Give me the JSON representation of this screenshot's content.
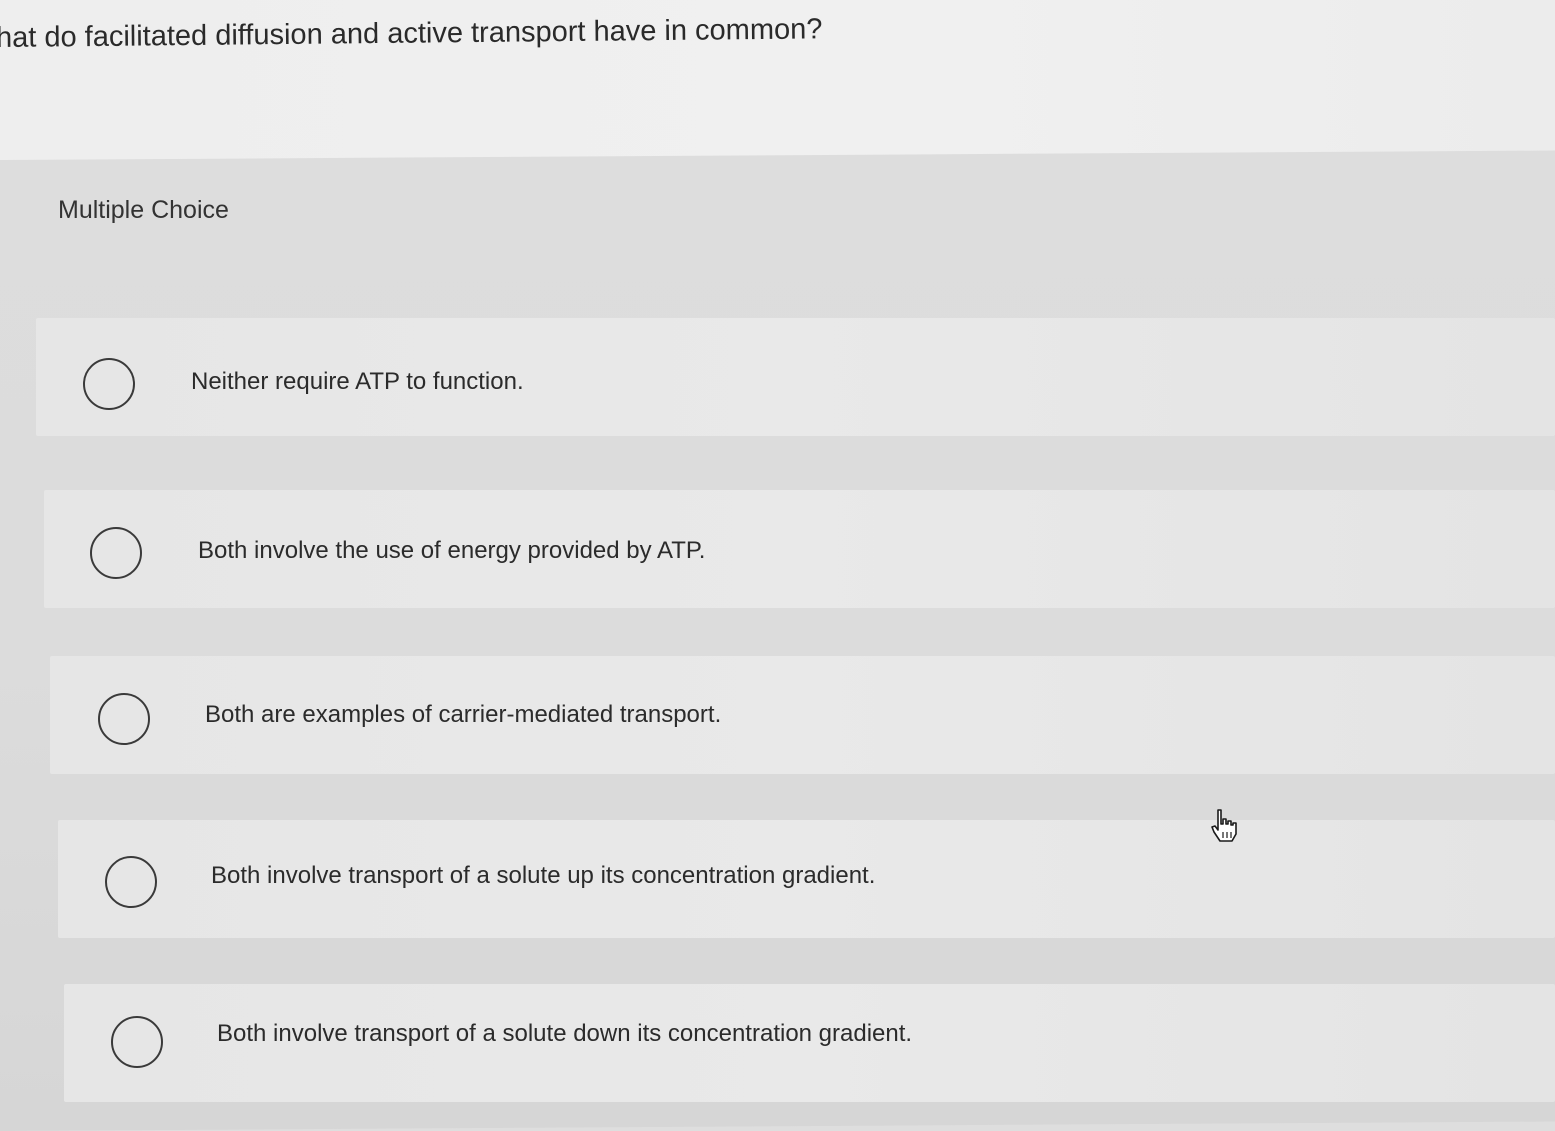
{
  "question": {
    "text": "hat do facilitated diffusion and active transport have in common?"
  },
  "section": {
    "label": "Multiple Choice"
  },
  "options": [
    {
      "label": "Neither require ATP to function."
    },
    {
      "label": "Both involve the use of energy provided by ATP."
    },
    {
      "label": "Both are examples of carrier-mediated transport."
    },
    {
      "label": "Both involve transport of a solute up its concentration gradient."
    },
    {
      "label": "Both involve transport of a solute down its concentration gradient."
    }
  ],
  "colors": {
    "text": "#2b2b2b",
    "radio_border": "#3a3a3a",
    "background": "#e6e6e6"
  },
  "icons": {
    "cursor": "hand-pointer-icon",
    "radio": "radio-unselected-icon"
  }
}
